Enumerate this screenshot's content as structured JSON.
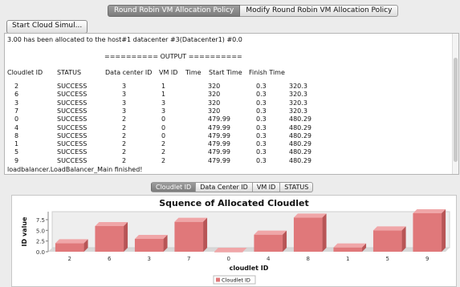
{
  "top_tabs": [
    {
      "label": "Round Robin VM Allocation Policy",
      "selected": true
    },
    {
      "label": "Modify Round Robin VM Allocation Policy",
      "selected": false
    }
  ],
  "start_button": "Start Cloud Simul...",
  "output": {
    "first_line": "3.00 has been allocated to the host#1 datacenter #3(Datacenter1) #0.0",
    "banner": "========== OUTPUT ==========",
    "headers": [
      "Cloudlet ID",
      "STATUS",
      "Data center ID",
      "VM ID",
      "Time",
      "Start Time",
      "Finish Time"
    ],
    "rows": [
      [
        "2",
        "SUCCESS",
        "3",
        "1",
        "320",
        "0.3",
        "320.3"
      ],
      [
        "6",
        "SUCCESS",
        "3",
        "1",
        "320",
        "0.3",
        "320.3"
      ],
      [
        "3",
        "SUCCESS",
        "3",
        "3",
        "320",
        "0.3",
        "320.3"
      ],
      [
        "7",
        "SUCCESS",
        "3",
        "3",
        "320",
        "0.3",
        "320.3"
      ],
      [
        "0",
        "SUCCESS",
        "2",
        "0",
        "479.99",
        "0.3",
        "480.29"
      ],
      [
        "4",
        "SUCCESS",
        "2",
        "0",
        "479.99",
        "0.3",
        "480.29"
      ],
      [
        "8",
        "SUCCESS",
        "2",
        "0",
        "479.99",
        "0.3",
        "480.29"
      ],
      [
        "1",
        "SUCCESS",
        "2",
        "2",
        "479.99",
        "0.3",
        "480.29"
      ],
      [
        "5",
        "SUCCESS",
        "2",
        "2",
        "479.99",
        "0.3",
        "480.29"
      ],
      [
        "9",
        "SUCCESS",
        "2",
        "2",
        "479.99",
        "0.3",
        "480.29"
      ]
    ],
    "last_line": "loadbalancer.LoadBalancer_Main finished!"
  },
  "chart_tabs": [
    {
      "label": "Cloudlet ID",
      "selected": true
    },
    {
      "label": "Data Center ID",
      "selected": false
    },
    {
      "label": "VM ID",
      "selected": false
    },
    {
      "label": "STATUS",
      "selected": false
    }
  ],
  "chart_data": {
    "type": "bar",
    "title": "Squence of Allocated Cloudlet",
    "xlabel": "cloudlet ID",
    "ylabel": "ID value",
    "categories": [
      "2",
      "6",
      "3",
      "7",
      "0",
      "4",
      "8",
      "1",
      "5",
      "9"
    ],
    "series": [
      {
        "name": "Cloudlet ID",
        "values": [
          2,
          6,
          3,
          7,
          0,
          4,
          8,
          1,
          5,
          9
        ]
      }
    ],
    "yticks": [
      "0.0",
      "2.5",
      "5.0",
      "7.5"
    ],
    "ylim": [
      0,
      9
    ],
    "colors": {
      "bar": "#e0787a",
      "bar_top": "#f0a6a8",
      "bar_side": "#b85556",
      "plot_bg": "#eeeeee"
    },
    "legend": "bottom-center"
  }
}
